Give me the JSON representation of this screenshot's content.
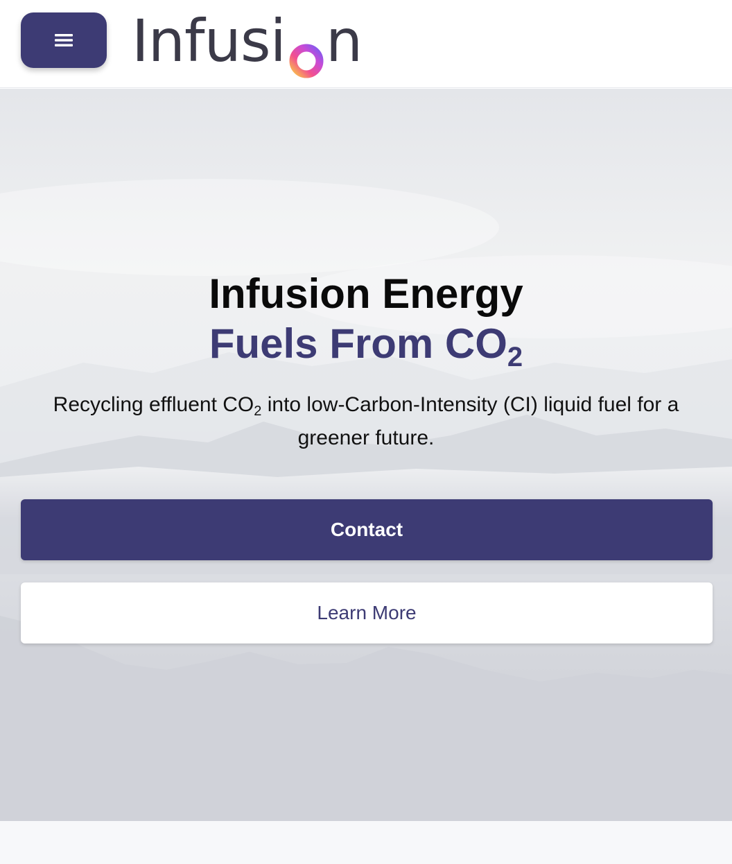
{
  "header": {
    "menu_icon": "hamburger-menu-icon",
    "logo_text_before": "Infusi",
    "logo_text_after": "n",
    "logo_ring_icon": "gradient-ring-logo-icon"
  },
  "hero": {
    "title": "Infusion Energy",
    "subtitle_main": "Fuels From CO",
    "subtitle_sub": "2",
    "desc_before": "Recycling effluent CO",
    "desc_sub": "2",
    "desc_after": " into low-Carbon-Intensity (CI) liquid fuel for a greener future.",
    "contact_label": "Contact",
    "learn_more_label": "Learn More",
    "background_image": "misty-mountains-image"
  },
  "colors": {
    "brand": "#3d3b74",
    "logo_text": "#3b3a48",
    "footer_bg": "#f7f8fa"
  }
}
